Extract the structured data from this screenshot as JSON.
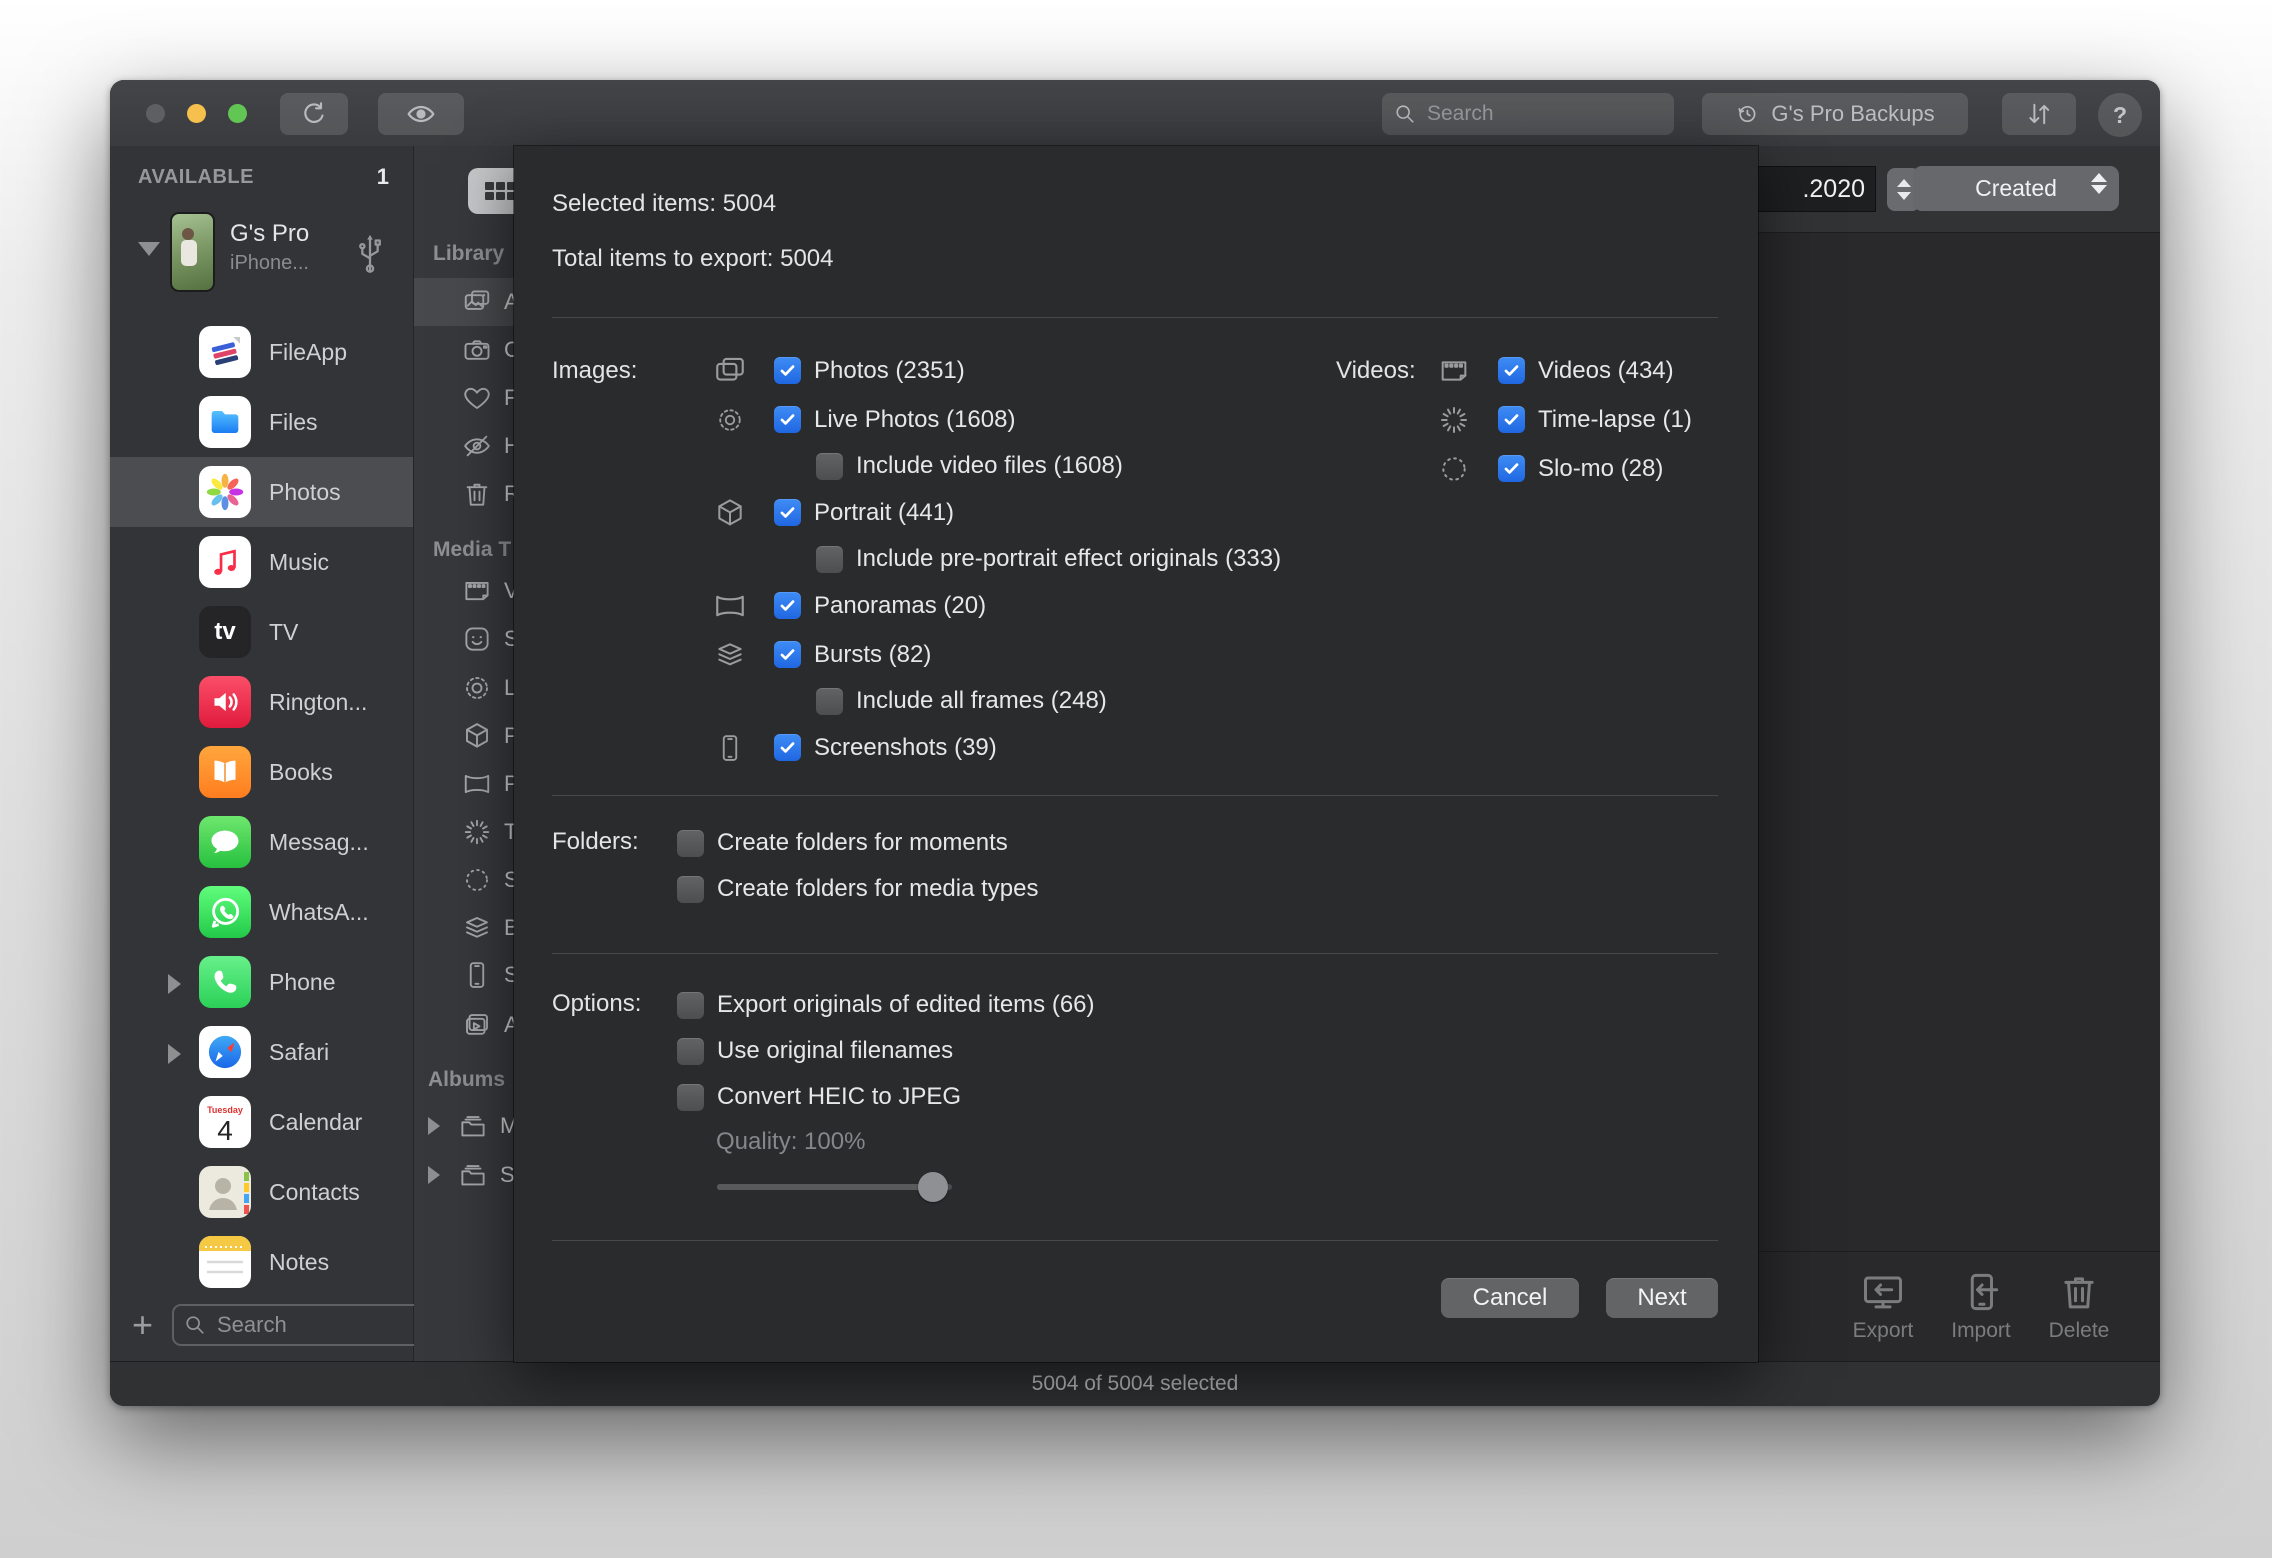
{
  "titlebar": {
    "search_placeholder": "Search",
    "backups_label": "G's Pro Backups",
    "help_label": "?"
  },
  "sidebar": {
    "header": "AVAILABLE",
    "count": "1",
    "device_name": "G's Pro",
    "device_sub": "iPhone...",
    "items": [
      {
        "label": "FileApp"
      },
      {
        "label": "Files"
      },
      {
        "label": "Photos",
        "selected": true
      },
      {
        "label": "Music"
      },
      {
        "label": "TV"
      },
      {
        "label": "Rington..."
      },
      {
        "label": "Books"
      },
      {
        "label": "Messag..."
      },
      {
        "label": "WhatsA..."
      },
      {
        "label": "Phone",
        "disclosure": true
      },
      {
        "label": "Safari",
        "disclosure": true
      },
      {
        "label": "Calendar"
      },
      {
        "label": "Contacts"
      },
      {
        "label": "Notes"
      }
    ],
    "add_label": "+",
    "search_placeholder": "Search"
  },
  "panel": {
    "library_header": "Library",
    "library_rows": [
      {
        "label": "A",
        "selected": true
      },
      {
        "label": "C"
      },
      {
        "label": "F"
      },
      {
        "label": "H"
      },
      {
        "label": "R"
      }
    ],
    "media_header": "Media T",
    "media_rows": [
      {
        "label": "V"
      },
      {
        "label": "S"
      },
      {
        "label": "L"
      },
      {
        "label": "P"
      },
      {
        "label": "P"
      },
      {
        "label": "T"
      },
      {
        "label": "S"
      },
      {
        "label": "B"
      },
      {
        "label": "S"
      },
      {
        "label": "A"
      }
    ],
    "albums_header": "Albums",
    "albums_rows": [
      {
        "label": "M"
      },
      {
        "label": "S"
      }
    ]
  },
  "content": {
    "date_filter": ".2020",
    "sort_by": "Created",
    "actions": [
      {
        "label": "Export"
      },
      {
        "label": "Import"
      },
      {
        "label": "Delete"
      }
    ],
    "status": "5004 of 5004 selected"
  },
  "dialog": {
    "selected_line": "Selected items: 5004",
    "total_line": "Total items to export: 5004",
    "images_label": "Images:",
    "img_rows": [
      {
        "label": "Photos (2351)",
        "checked": true
      },
      {
        "label": "Live Photos (1608)",
        "checked": true
      },
      {
        "label": "Include video files (1608)",
        "checked": false
      },
      {
        "label": "Portrait (441)",
        "checked": true
      },
      {
        "label": "Include pre-portrait effect originals (333)",
        "checked": false
      },
      {
        "label": "Panoramas (20)",
        "checked": true
      },
      {
        "label": "Bursts (82)",
        "checked": true
      },
      {
        "label": "Include all frames (248)",
        "checked": false
      },
      {
        "label": "Screenshots (39)",
        "checked": true
      }
    ],
    "videos_label": "Videos:",
    "vid_rows": [
      {
        "label": "Videos (434)",
        "checked": true
      },
      {
        "label": "Time-lapse (1)",
        "checked": true
      },
      {
        "label": "Slo-mo (28)",
        "checked": true
      }
    ],
    "folders_label": "Folders:",
    "folder_rows": [
      {
        "label": "Create folders for moments",
        "checked": false
      },
      {
        "label": "Create folders for media types",
        "checked": false
      }
    ],
    "options_label": "Options:",
    "option_rows": [
      {
        "label": "Export originals of edited items (66)",
        "checked": false
      },
      {
        "label": "Use original filenames",
        "checked": false
      },
      {
        "label": "Convert HEIC to JPEG",
        "checked": false
      }
    ],
    "quality_label": "Quality: 100%",
    "quality_value": 100,
    "cancel_label": "Cancel",
    "next_label": "Next",
    "accent_color": "#2b79ea"
  }
}
